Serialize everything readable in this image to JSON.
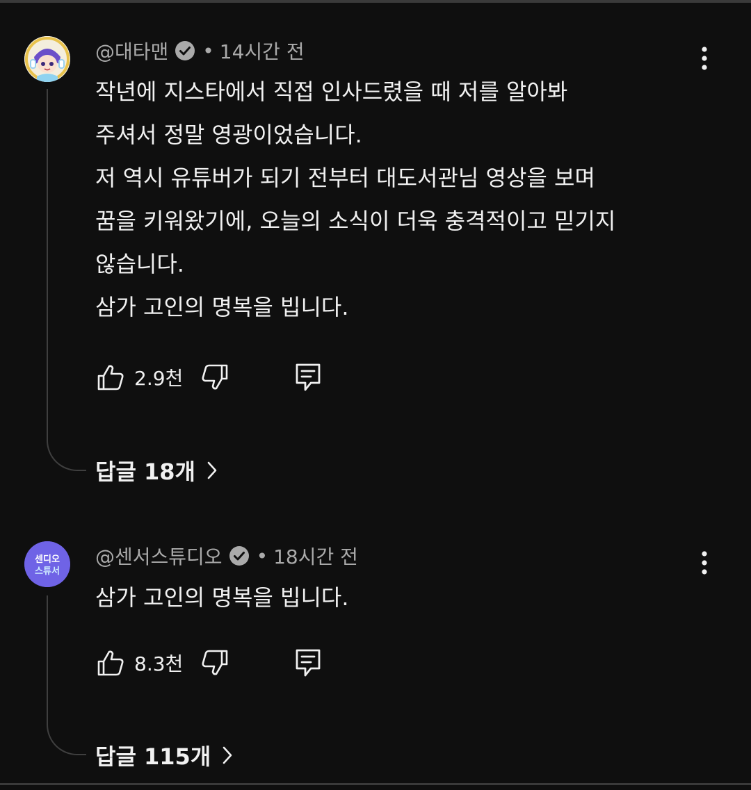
{
  "comments": [
    {
      "author": "@대타맨",
      "time": "14시간 전",
      "lines": [
        "작년에 지스타에서 직접 인사드렸을 때 저를 알아봐",
        "주셔서 정말 영광이었습니다.",
        "저 역시 유튜버가 되기 전부터 대도서관님 영상을 보며",
        "꿈을 키워왔기에, 오늘의 소식이 더욱 충격적이고 믿기지",
        "않습니다.",
        "삼가 고인의 명복을 빕니다."
      ],
      "likes": "2.9천",
      "replies_label": "답글 18개"
    },
    {
      "author": "@센서스튜디오",
      "time": "18시간 전",
      "lines": [
        "삼가 고인의 명복을 빕니다."
      ],
      "likes": "8.3천",
      "replies_label": "답글 115개",
      "avatar_text_top": "센디오",
      "avatar_text_bottom": "스튜서"
    }
  ],
  "separator": "•",
  "colors": {
    "background": "#0f0f0f",
    "text": "#f1f1f1",
    "meta": "#aaaaaa",
    "avatar2": "#6f63e6"
  },
  "icons": [
    "verified-icon",
    "more-vert-icon",
    "thumb-up-icon",
    "thumb-down-icon",
    "reply-icon",
    "chevron-right-icon"
  ]
}
